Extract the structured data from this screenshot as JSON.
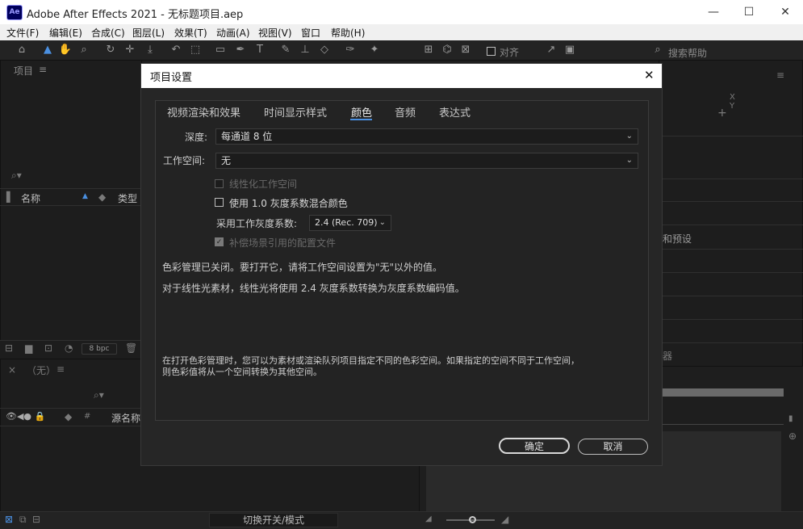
{
  "window": {
    "title": "Adobe After Effects 2021 - 无标题项目.aep",
    "app_icon": "Ae",
    "minimize": "—",
    "maximize": "☐",
    "close": "✕"
  },
  "menubar": [
    "文件(F)",
    "编辑(E)",
    "合成(C)",
    "图层(L)",
    "效果(T)",
    "动画(A)",
    "视图(V)",
    "窗口",
    "帮助(H)"
  ],
  "toolbar": {
    "align_label": "对齐",
    "search_placeholder": "搜索帮助"
  },
  "project_panel": {
    "title": "项目",
    "menu_icon": "≡",
    "col_name": "名称",
    "col_type": "类型",
    "bpc": "8 bpc"
  },
  "timeline_panel": {
    "comp_name": "（无）",
    "col_source": "源名称",
    "toggle_label": "切换开关/模式"
  },
  "right_panel": {
    "info_x": "X",
    "info_y": "Y",
    "presets_label": "和预设",
    "partial_label": "器"
  },
  "dialog": {
    "title": "项目设置",
    "close": "✕",
    "tabs": [
      "视频渲染和效果",
      "时间显示样式",
      "颜色",
      "音频",
      "表达式"
    ],
    "active_tab": 2,
    "depth_label": "深度:",
    "depth_value": "每通道 8 位",
    "workspace_label": "工作空间:",
    "workspace_value": "无",
    "linearize_label": "线性化工作空间",
    "blend_label": "使用 1.0 灰度系数混合颜色",
    "gamma_label": "采用工作灰度系数:",
    "gamma_value": "2.4 (Rec. 709)",
    "compensate_label": "补偿场景引用的配置文件",
    "info1": "色彩管理已关闭。要打开它，请将工作空间设置为\"无\"以外的值。",
    "info2": "对于线性光素材，线性光将使用 2.4 灰度系数转换为灰度系数编码值。",
    "info3_line1": "在打开色彩管理时，您可以为素材或渲染队列项目指定不同的色彩空间。如果指定的空间不同于工作空间，",
    "info3_line2": "则色彩值将从一个空间转换为其他空间。",
    "ok": "确定",
    "cancel": "取消"
  }
}
